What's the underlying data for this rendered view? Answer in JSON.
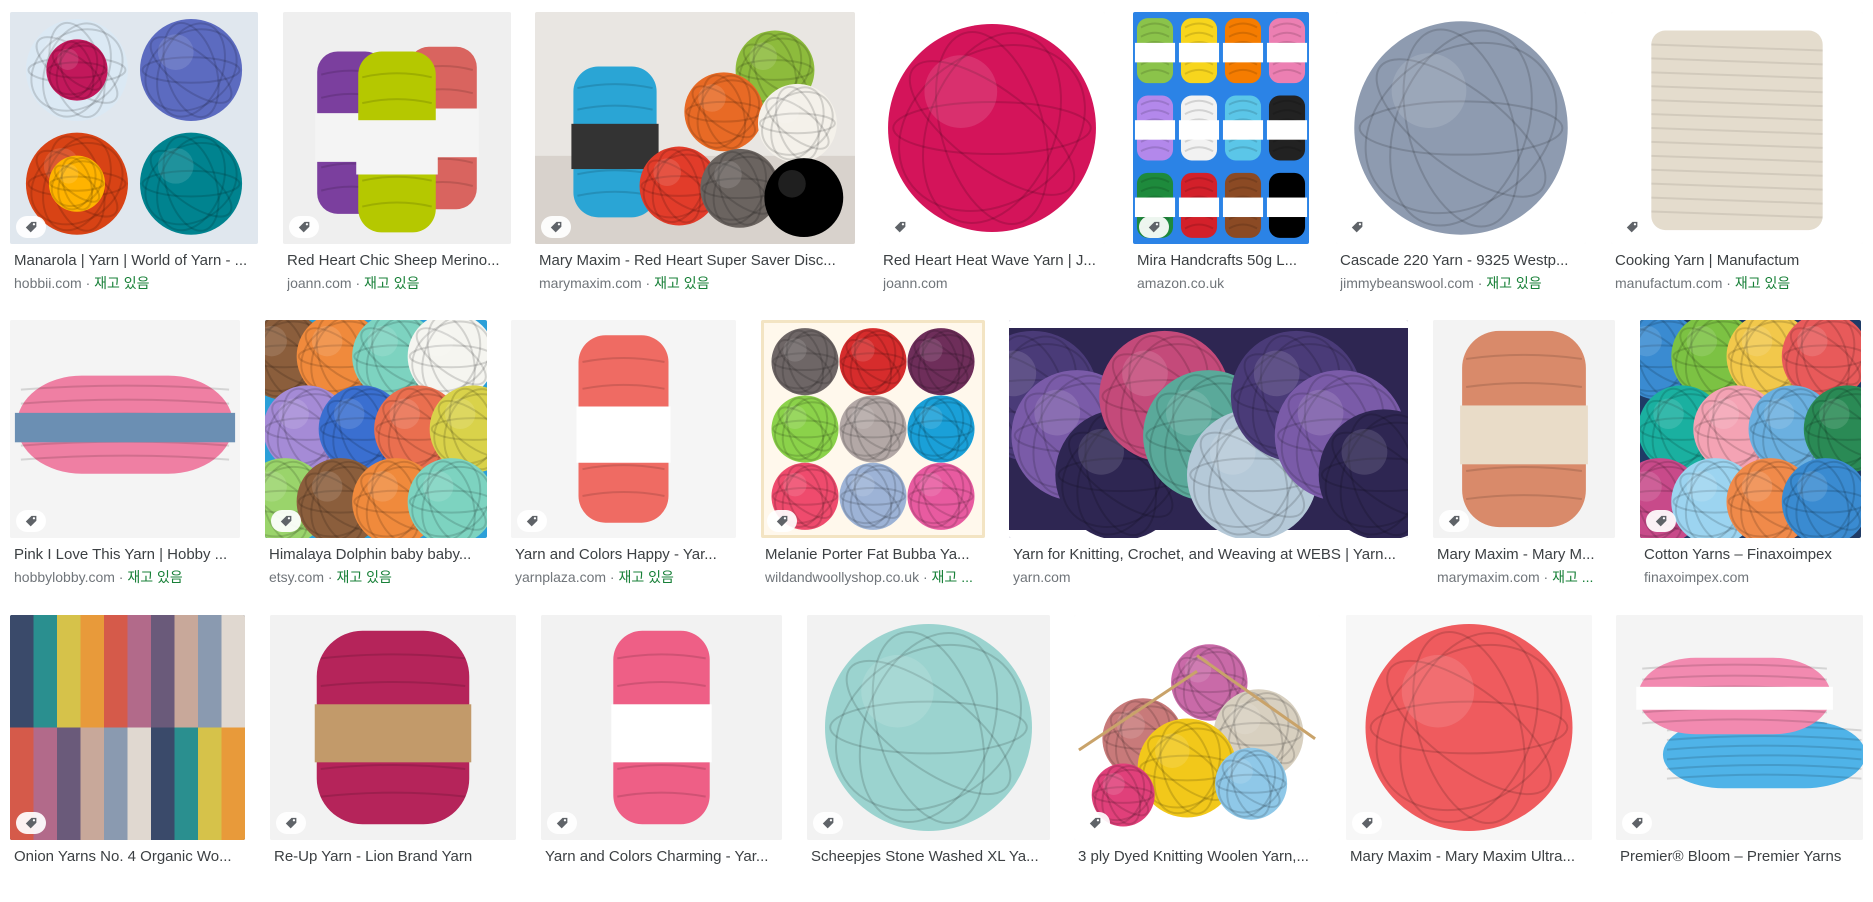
{
  "colors": {
    "title": "#3c4043",
    "source": "#70757a",
    "stock": "#188038"
  },
  "icons": {
    "product_tag": "tag-icon"
  },
  "results": [
    {
      "title": "Manarola | Yarn | World of Yarn - ...",
      "source": "hobbii.com",
      "stock": "재고 있음",
      "colors": [
        "#e0e7ee",
        "#c2185b",
        "#5c6bc0",
        "#ffb300",
        "#00838f",
        "#d84315"
      ]
    },
    {
      "title": "Red Heart Chic Sheep Merino...",
      "source": "joann.com",
      "stock": "재고 있음",
      "colors": [
        "#efefef",
        "#7b3f9e",
        "#b5c800",
        "#d9645f"
      ]
    },
    {
      "title": "Mary Maxim - Red Heart Super Saver Disc...",
      "source": "marymaxim.com",
      "stock": "재고 있음",
      "colors": [
        "#e9e6e2",
        "#2aa5d5",
        "#3b6fb6",
        "#8dbb3c",
        "#e86a25",
        "#f4f1ea",
        "#e23c2a",
        "#6b6460"
      ]
    },
    {
      "title": "Red Heart Heat Wave Yarn | J...",
      "source": "joann.com",
      "stock": "",
      "colors": [
        "#ffffff",
        "#d4145a"
      ]
    },
    {
      "title": "Mira Handcrafts 50g L...",
      "source": "amazon.co.uk",
      "stock": "",
      "colors": [
        "#2b83e6",
        "#8bc34a",
        "#f7d51d",
        "#f57c00",
        "#ec7fb2",
        "#b388eb",
        "#f2f2f2",
        "#5bc6e8",
        "#222222",
        "#1e8a3c",
        "#d3202a",
        "#8b4a24"
      ]
    },
    {
      "title": "Cascade 220 Yarn - 9325 Westp...",
      "source": "jimmybeanswool.com",
      "stock": "재고 있음",
      "colors": [
        "#ffffff",
        "#8e9bb0"
      ]
    },
    {
      "title": "Cooking Yarn | Manufactum",
      "source": "manufactum.com",
      "stock": "재고 있음",
      "colors": [
        "#ffffff",
        "#e4dccd"
      ]
    },
    {
      "title": "Pink I Love This Yarn | Hobby ...",
      "source": "hobbylobby.com",
      "stock": "재고 있음",
      "colors": [
        "#f4f4f4",
        "#ef7fa3",
        "#6b8fb3"
      ]
    },
    {
      "title": "Himalaya Dolphin baby baby...",
      "source": "etsy.com",
      "stock": "재고 있음",
      "colors": [
        "#2b9fd8",
        "#8b5e3c",
        "#f08a3c",
        "#7dd3c0",
        "#f5f5f0",
        "#a58bd6",
        "#3a6fd0",
        "#ea6f4f",
        "#d9d24a",
        "#9ad46b"
      ]
    },
    {
      "title": "Yarn and Colors Happy - Yar...",
      "source": "yarnplaza.com",
      "stock": "재고 있음",
      "colors": [
        "#f5f5f5",
        "#ef6b63"
      ]
    },
    {
      "title": "Melanie Porter Fat Bubba Ya...",
      "source": "wildandwoollyshop.co.uk",
      "stock": "재고 ...",
      "colors": [
        "#f3e4c3",
        "#6e6666",
        "#d62c2c",
        "#6e2e5a",
        "#8bd24a",
        "#b3a8a6",
        "#1aa0d8",
        "#ef4b6d",
        "#9db3d6",
        "#e85ba0"
      ]
    },
    {
      "title": "Yarn for Knitting, Crochet, and Weaving at WEBS | Yarn...",
      "source": "yarn.com",
      "stock": "",
      "colors": [
        "#4a3b78",
        "#7a5ba8",
        "#2e2652",
        "#c44a7a",
        "#5aa99a",
        "#b5c9d8"
      ]
    },
    {
      "title": "Mary Maxim - Mary M...",
      "source": "marymaxim.com",
      "stock": "재고 ...",
      "colors": [
        "#f3f3f3",
        "#d98a6a",
        "#5b8fb0",
        "#e9dcc8"
      ]
    },
    {
      "title": "Cotton Yarns – Finaxoimpex",
      "source": "finaxoimpex.com",
      "stock": "",
      "colors": [
        "#1f3b66",
        "#3a8bd1",
        "#7cc243",
        "#f2c84b",
        "#e85a5a",
        "#1ab0a0",
        "#f4a3b4",
        "#6bb0e0",
        "#2a8a55",
        "#c84a8a",
        "#9cd4f0",
        "#f08a4a"
      ]
    },
    {
      "title": "Onion Yarns No. 4 Organic Wo...",
      "source": "",
      "stock": "",
      "colors": [
        "#3a4a6a",
        "#2a8f8f",
        "#d6c24a",
        "#e89a3a",
        "#d55a4a",
        "#b26a8a",
        "#6a5a7a",
        "#c8a89a",
        "#8a9ab0",
        "#e0d8d0"
      ]
    },
    {
      "title": "Re-Up Yarn - Lion Brand Yarn",
      "source": "",
      "stock": "",
      "colors": [
        "#f2f2f2",
        "#b5245a",
        "#c29a6a"
      ]
    },
    {
      "title": "Yarn and Colors Charming - Yar...",
      "source": "",
      "stock": "",
      "colors": [
        "#f2f2f2",
        "#ee5f86"
      ]
    },
    {
      "title": "Scheepjes Stone Washed XL Ya...",
      "source": "",
      "stock": "",
      "colors": [
        "#f2f2f2",
        "#9bd3cf"
      ]
    },
    {
      "title": "3 ply Dyed Knitting Woolen Yarn,...",
      "source": "",
      "stock": "",
      "colors": [
        "#ffffff",
        "#c96aa8",
        "#f2c81a",
        "#8fc8e8",
        "#d8d0c0",
        "#e0407a",
        "#c87a7a"
      ]
    },
    {
      "title": "Mary Maxim - Mary Maxim Ultra...",
      "source": "",
      "stock": "",
      "colors": [
        "#f7f7f7",
        "#ef5b5e"
      ]
    },
    {
      "title": "Premier® Bloom – Premier Yarns",
      "source": "",
      "stock": "",
      "colors": [
        "#f4f4f4",
        "#f28ab0",
        "#4fb3e8",
        "#8bc34a"
      ]
    }
  ]
}
